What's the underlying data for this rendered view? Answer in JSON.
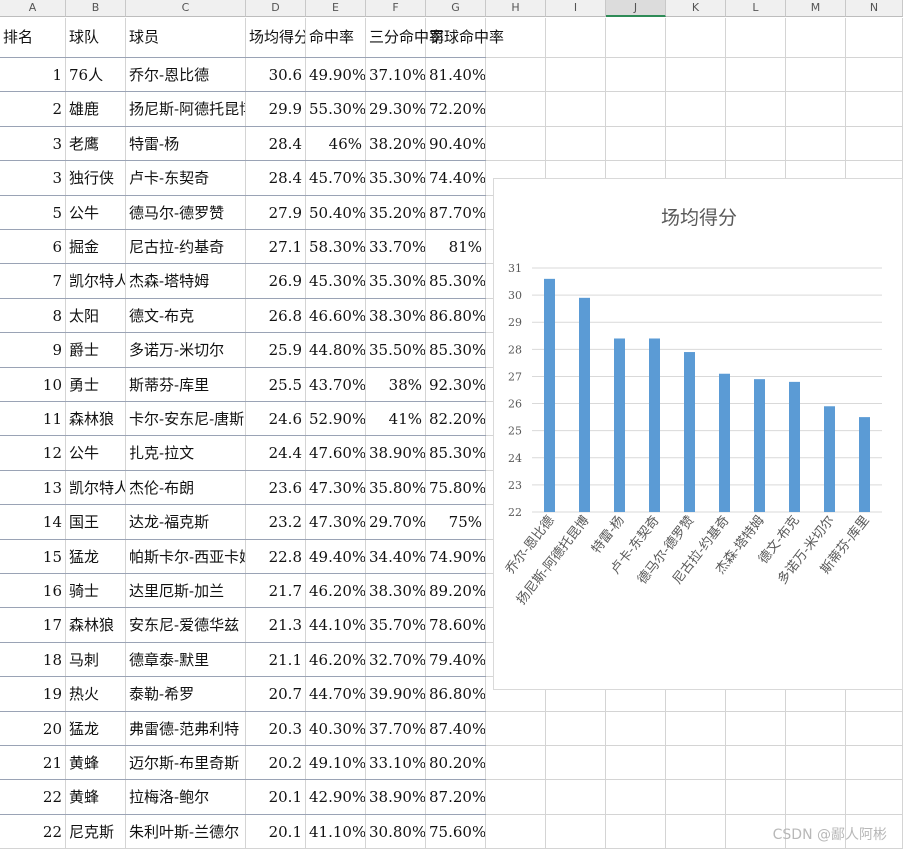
{
  "column_letters": [
    "A",
    "B",
    "C",
    "D",
    "E",
    "F",
    "G",
    "H",
    "I",
    "J",
    "K",
    "L",
    "M",
    "N"
  ],
  "selected_column": "J",
  "table": {
    "headers": [
      "排名",
      "球队",
      "球员",
      "场均得分",
      "命中率",
      "三分命中率",
      "罚球命中率"
    ],
    "rows": [
      [
        "1",
        "76人",
        "乔尔-恩比德",
        "30.6",
        "49.90%",
        "37.10%",
        "81.40%"
      ],
      [
        "2",
        "雄鹿",
        "扬尼斯-阿德托昆博",
        "29.9",
        "55.30%",
        "29.30%",
        "72.20%"
      ],
      [
        "3",
        "老鹰",
        "特雷-杨",
        "28.4",
        "46%",
        "38.20%",
        "90.40%"
      ],
      [
        "3",
        "独行侠",
        "卢卡-东契奇",
        "28.4",
        "45.70%",
        "35.30%",
        "74.40%"
      ],
      [
        "5",
        "公牛",
        "德马尔-德罗赞",
        "27.9",
        "50.40%",
        "35.20%",
        "87.70%"
      ],
      [
        "6",
        "掘金",
        "尼古拉-约基奇",
        "27.1",
        "58.30%",
        "33.70%",
        "81%"
      ],
      [
        "7",
        "凯尔特人",
        "杰森-塔特姆",
        "26.9",
        "45.30%",
        "35.30%",
        "85.30%"
      ],
      [
        "8",
        "太阳",
        "德文-布克",
        "26.8",
        "46.60%",
        "38.30%",
        "86.80%"
      ],
      [
        "9",
        "爵士",
        "多诺万-米切尔",
        "25.9",
        "44.80%",
        "35.50%",
        "85.30%"
      ],
      [
        "10",
        "勇士",
        "斯蒂芬-库里",
        "25.5",
        "43.70%",
        "38%",
        "92.30%"
      ],
      [
        "11",
        "森林狼",
        "卡尔-安东尼-唐斯",
        "24.6",
        "52.90%",
        "41%",
        "82.20%"
      ],
      [
        "12",
        "公牛",
        "扎克-拉文",
        "24.4",
        "47.60%",
        "38.90%",
        "85.30%"
      ],
      [
        "13",
        "凯尔特人",
        "杰伦-布朗",
        "23.6",
        "47.30%",
        "35.80%",
        "75.80%"
      ],
      [
        "14",
        "国王",
        "达龙-福克斯",
        "23.2",
        "47.30%",
        "29.70%",
        "75%"
      ],
      [
        "15",
        "猛龙",
        "帕斯卡尔-西亚卡姆",
        "22.8",
        "49.40%",
        "34.40%",
        "74.90%"
      ],
      [
        "16",
        "骑士",
        "达里厄斯-加兰",
        "21.7",
        "46.20%",
        "38.30%",
        "89.20%"
      ],
      [
        "17",
        "森林狼",
        "安东尼-爱德华兹",
        "21.3",
        "44.10%",
        "35.70%",
        "78.60%"
      ],
      [
        "18",
        "马刺",
        "德章泰-默里",
        "21.1",
        "46.20%",
        "32.70%",
        "79.40%"
      ],
      [
        "19",
        "热火",
        "泰勒-希罗",
        "20.7",
        "44.70%",
        "39.90%",
        "86.80%"
      ],
      [
        "20",
        "猛龙",
        "弗雷德-范弗利特",
        "20.3",
        "40.30%",
        "37.70%",
        "87.40%"
      ],
      [
        "21",
        "黄蜂",
        "迈尔斯-布里奇斯",
        "20.2",
        "49.10%",
        "33.10%",
        "80.20%"
      ],
      [
        "22",
        "黄蜂",
        "拉梅洛-鲍尔",
        "20.1",
        "42.90%",
        "38.90%",
        "87.20%"
      ],
      [
        "22",
        "尼克斯",
        "朱利叶斯-兰德尔",
        "20.1",
        "41.10%",
        "30.80%",
        "75.60%"
      ]
    ]
  },
  "chart_data": {
    "type": "bar",
    "title": "场均得分",
    "categories": [
      "乔尔-恩比德",
      "扬尼斯-阿德托昆博",
      "特雷-杨",
      "卢卡-东契奇",
      "德马尔-德罗赞",
      "尼古拉-约基奇",
      "杰森-塔特姆",
      "德文-布克",
      "多诺万-米切尔",
      "斯蒂芬-库里"
    ],
    "values": [
      30.6,
      29.9,
      28.4,
      28.4,
      27.9,
      27.1,
      26.9,
      26.8,
      25.9,
      25.5
    ],
    "ylim": [
      22,
      31
    ],
    "yticks": [
      22,
      23,
      24,
      25,
      26,
      27,
      28,
      29,
      30,
      31
    ],
    "grid": true,
    "legend": "none",
    "bar_color": "#5b9bd5"
  },
  "watermark": "CSDN @鄙人阿彬"
}
